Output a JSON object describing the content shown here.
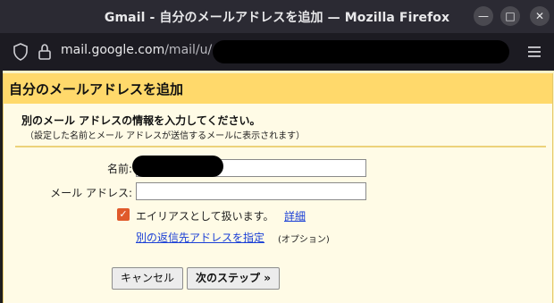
{
  "window": {
    "title": "Gmail - 自分のメールアドレスを追加 — Mozilla Firefox",
    "min_icon": "minimize-icon",
    "max_icon": "maximize-icon",
    "close_icon": "close-icon",
    "min_glyph": "—",
    "max_glyph": "□",
    "close_glyph": "✕"
  },
  "urlbar": {
    "url_host": "mail.google.com",
    "url_path": "/mail/u/",
    "shield_icon": "tracking-shield-icon",
    "lock_icon": "lock-icon",
    "menu_icon": "hamburger-menu-icon"
  },
  "dialog": {
    "title": "自分のメールアドレスを追加",
    "heading": "別のメール アドレスの情報を入力してください。",
    "note": "（設定した名前とメール アドレスが送信するメールに表示されます）",
    "name_label": "名前:",
    "name_value": "",
    "email_label": "メール アドレス:",
    "email_value": "",
    "alias_checked": true,
    "alias_label": "エイリアスとして扱います。",
    "alias_detail_link": "詳細",
    "reply_to_link": "別の返信先アドレスを指定",
    "reply_to_optional": "(オプション)",
    "cancel_button": "キャンセル",
    "next_button": "次のステップ »",
    "accent_color": "#ffd96b",
    "checkbox_color": "#e05a2b",
    "link_color": "#1a3fd6"
  }
}
